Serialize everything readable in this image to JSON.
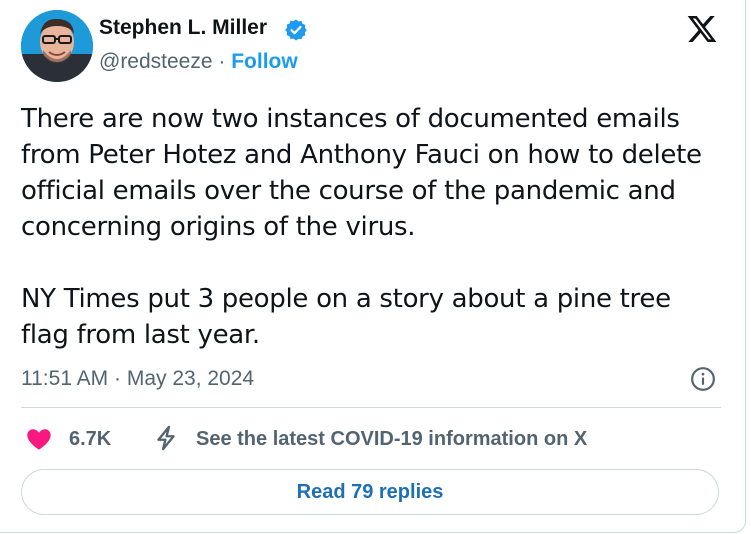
{
  "author": {
    "name": "Stephen L. Miller",
    "handle": "@redsteeze",
    "separator": " · ",
    "follow_label": "Follow",
    "verified_icon": "verified-badge-icon",
    "avatar_icon": "avatar"
  },
  "brand": {
    "logo": "x-logo-icon"
  },
  "tweet": {
    "paragraphs": [
      "There are now two instances of documented emails from Peter Hotez and Anthony Fauci on how to delete official emails over the course of the pandemic and concerning origins of the virus.",
      "NY Times put 3 people on a story about a pine tree flag from last year."
    ],
    "timestamp": "11:51 AM · May 23, 2024"
  },
  "actions": {
    "like_count": "6.7K",
    "info_link": "See the latest COVID-19 information on X",
    "read_replies_label": "Read 79 replies"
  },
  "colors": {
    "accent": "#1d9bf0",
    "heart": "#f91880",
    "text": "#0f1419",
    "secondary": "#536471",
    "border": "#cfd9de"
  }
}
